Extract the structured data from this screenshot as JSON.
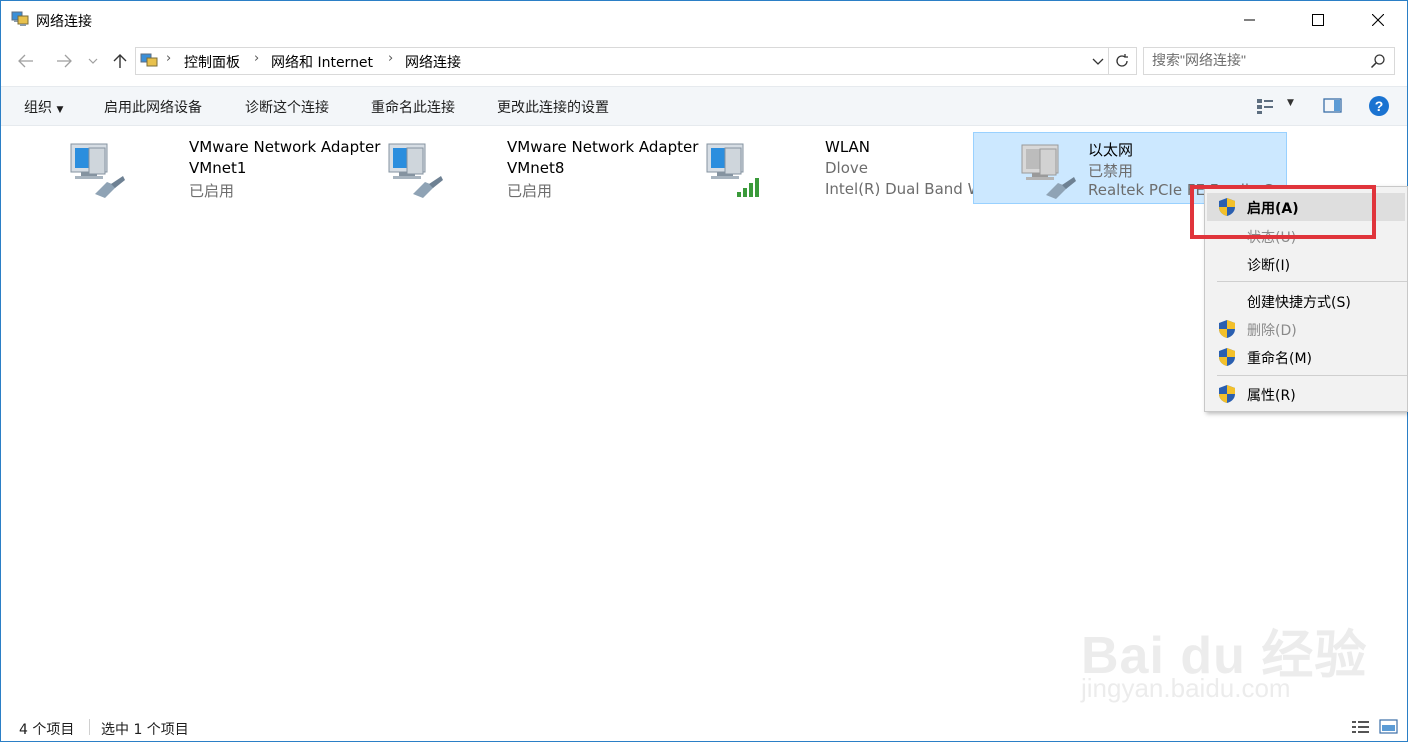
{
  "window": {
    "title": "网络连接",
    "controls": {
      "minimize": "minimize-icon",
      "maximize": "maximize-icon",
      "close": "close-icon"
    }
  },
  "address": {
    "crumbs": [
      "控制面板",
      "网络和 Internet",
      "网络连接"
    ],
    "search_placeholder": "搜索\"网络连接\""
  },
  "toolbar": {
    "organize": "组织",
    "enable_device": "启用此网络设备",
    "diagnose": "诊断这个连接",
    "rename": "重命名此连接",
    "change_settings": "更改此连接的设置"
  },
  "connections": [
    {
      "name": "VMware Network Adapter",
      "line2": "VMnet1",
      "line3": "已启用",
      "type": "wired",
      "selected": false
    },
    {
      "name": "VMware Network Adapter",
      "line2": "VMnet8",
      "line3": "已启用",
      "type": "wired",
      "selected": false
    },
    {
      "name": "WLAN",
      "line2": "Dlove",
      "line3": "Intel(R) Dual Band Wirele...",
      "type": "wireless",
      "selected": false
    },
    {
      "name": "以太网",
      "line2": "已禁用",
      "line3": "Realtek PCIe FE Family C...",
      "type": "wired-disabled",
      "selected": true
    }
  ],
  "context_menu": {
    "items": [
      {
        "label": "启用(A)",
        "shield": true,
        "highlighted": true,
        "disabled": false,
        "bold": true
      },
      {
        "label": "状态(U)",
        "shield": false,
        "highlighted": false,
        "disabled": true
      },
      {
        "label": "诊断(I)",
        "shield": false,
        "highlighted": false,
        "disabled": false
      },
      {
        "label": "创建快捷方式(S)",
        "shield": false,
        "highlighted": false,
        "disabled": false
      },
      {
        "label": "删除(D)",
        "shield": true,
        "highlighted": false,
        "disabled": true
      },
      {
        "label": "重命名(M)",
        "shield": true,
        "highlighted": false,
        "disabled": false
      },
      {
        "label": "属性(R)",
        "shield": true,
        "highlighted": false,
        "disabled": false
      }
    ]
  },
  "status": {
    "count": "4 个项目",
    "selected": "选中 1 个项目"
  },
  "watermark": {
    "line1": "Bai du 经验",
    "line2": "jingyan.baidu.com"
  },
  "colors": {
    "selection_bg": "#cce8ff",
    "selection_border": "#99d1ff",
    "highlight_box": "#e0343b",
    "help_blue": "#1a73d1"
  }
}
